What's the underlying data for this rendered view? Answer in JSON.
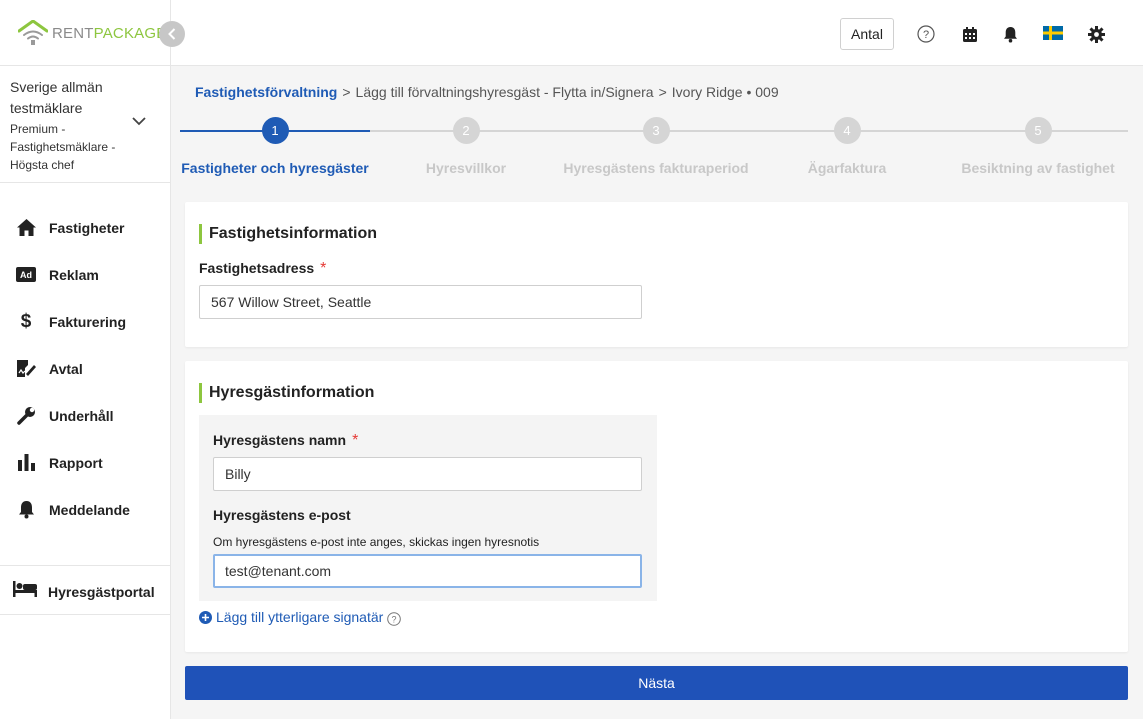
{
  "brand": {
    "name_part1": "RENT",
    "name_part2": "PACKAGE"
  },
  "account": {
    "name": "Sverige allmän testmäklare",
    "role": "Premium - Fastighetsmäklare - Högsta chef"
  },
  "nav": [
    {
      "label": "Fastigheter",
      "icon": "home-icon"
    },
    {
      "label": "Reklam",
      "icon": "ad-icon"
    },
    {
      "label": "Fakturering",
      "icon": "dollar-icon"
    },
    {
      "label": "Avtal",
      "icon": "contract-icon"
    },
    {
      "label": "Underhåll",
      "icon": "wrench-icon"
    },
    {
      "label": "Rapport",
      "icon": "bar-chart-icon"
    },
    {
      "label": "Meddelande",
      "icon": "bell-icon"
    }
  ],
  "portal": {
    "label": "Hyresgästportal",
    "icon": "bed-icon"
  },
  "header": {
    "antal_label": "Antal"
  },
  "breadcrumb": {
    "root": "Fastighetsförvaltning",
    "page": "Lägg till förvaltningshyresgäst - Flytta in/Signera",
    "property": "Ivory Ridge • 009"
  },
  "steps": [
    {
      "number": "1",
      "label": "Fastigheter och hyresgäster",
      "active": true
    },
    {
      "number": "2",
      "label": "Hyresvillkor",
      "active": false
    },
    {
      "number": "3",
      "label": "Hyresgästens fakturaperiod",
      "active": false
    },
    {
      "number": "4",
      "label": "Ägarfaktura",
      "active": false
    },
    {
      "number": "5",
      "label": "Besiktning av fastighet",
      "active": false
    }
  ],
  "property_section": {
    "title": "Fastighetsinformation",
    "address_label": "Fastighetsadress",
    "address_value": "567 Willow Street, Seattle"
  },
  "tenant_section": {
    "title": "Hyresgästinformation",
    "name_label": "Hyresgästens namn",
    "name_value": "Billy",
    "email_label": "Hyresgästens e-post",
    "email_hint": "Om hyresgästens e-post inte anges, skickas ingen hyresnotis",
    "email_value": "test@tenant.com",
    "add_signer_label": "Lägg till ytterligare signatär"
  },
  "required_mark": "*",
  "next_button": "Nästa",
  "colors": {
    "primary": "#1f5bb5",
    "accent_green": "#8dc63f",
    "required_red": "#e53935",
    "inactive_step": "#d5d5d5"
  }
}
